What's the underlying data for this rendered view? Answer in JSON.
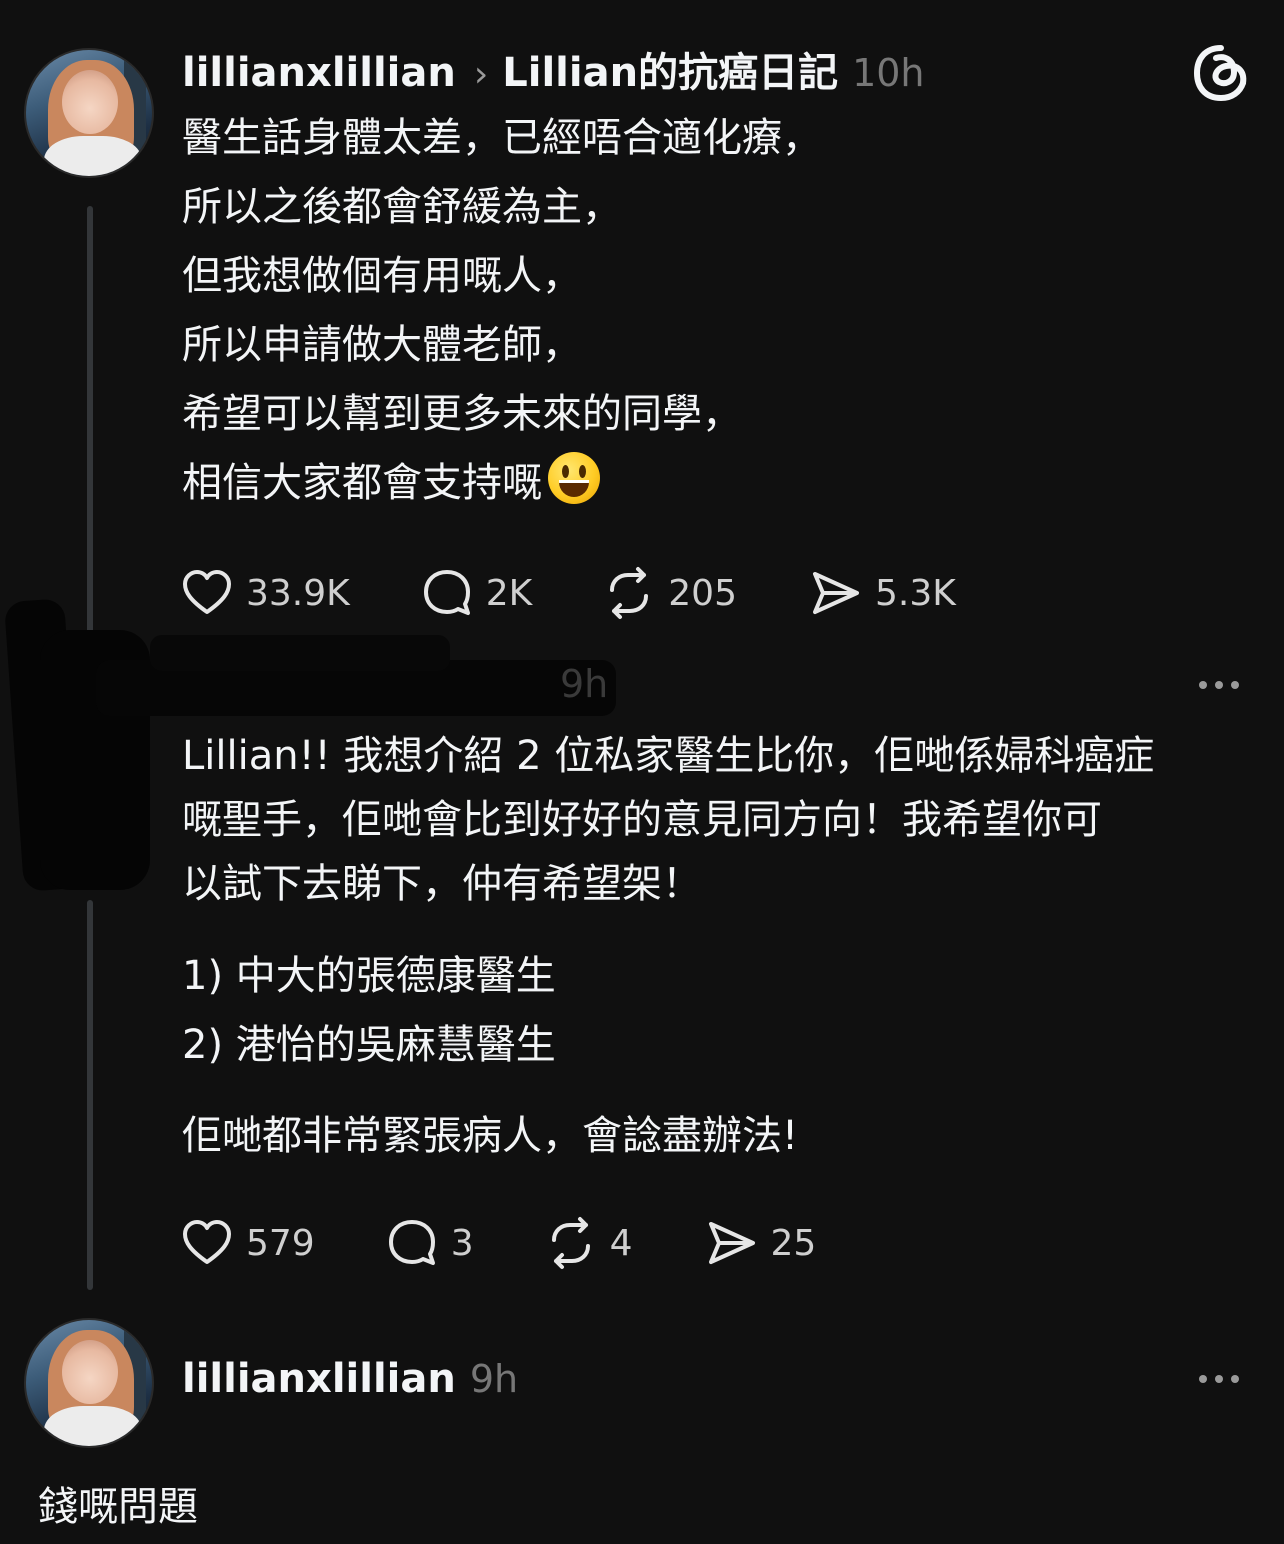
{
  "post": {
    "username": "lillianxlillian",
    "topic": "Lillian的抗癌日記",
    "time": "10h",
    "lines": [
      "醫生話身體太差，已經唔合適化療，",
      "所以之後都會舒緩為主，",
      "但我想做個有用嘅人，",
      "所以申請做大體老師，",
      "希望可以幫到更多未來的同學，",
      "相信大家都會支持嘅"
    ],
    "emoji": "smiling-face-icon",
    "likes": "33.9K",
    "comments": "2K",
    "reposts": "205",
    "shares": "5.3K"
  },
  "comment": {
    "time_partial": "9h",
    "paragraph1": [
      "Lillian!! 我想介紹 2 位私家醫生比你，佢哋係婦科癌症",
      "嘅聖手，佢哋會比到好好的意見同方向！我希望你可",
      "以試下去睇下，仲有希望架！"
    ],
    "list": [
      "1) 中大的張德康醫生",
      "2) 港怡的吳麻慧醫生"
    ],
    "closing": "佢哋都非常緊張病人，會諗盡辦法!",
    "likes": "579",
    "comments": "3",
    "reposts": "4",
    "shares": "25"
  },
  "reply": {
    "username": "lillianxlillian",
    "time": "9h",
    "text": "錢嘅問題"
  },
  "icons": {
    "logo": "threads-logo-icon",
    "like": "heart-icon",
    "comment": "speech-bubble-icon",
    "repost": "repost-icon",
    "share": "send-icon",
    "more": "more-dots-icon"
  },
  "colors": {
    "background": "#101010",
    "text": "#f3f5f7",
    "muted": "#777777"
  }
}
